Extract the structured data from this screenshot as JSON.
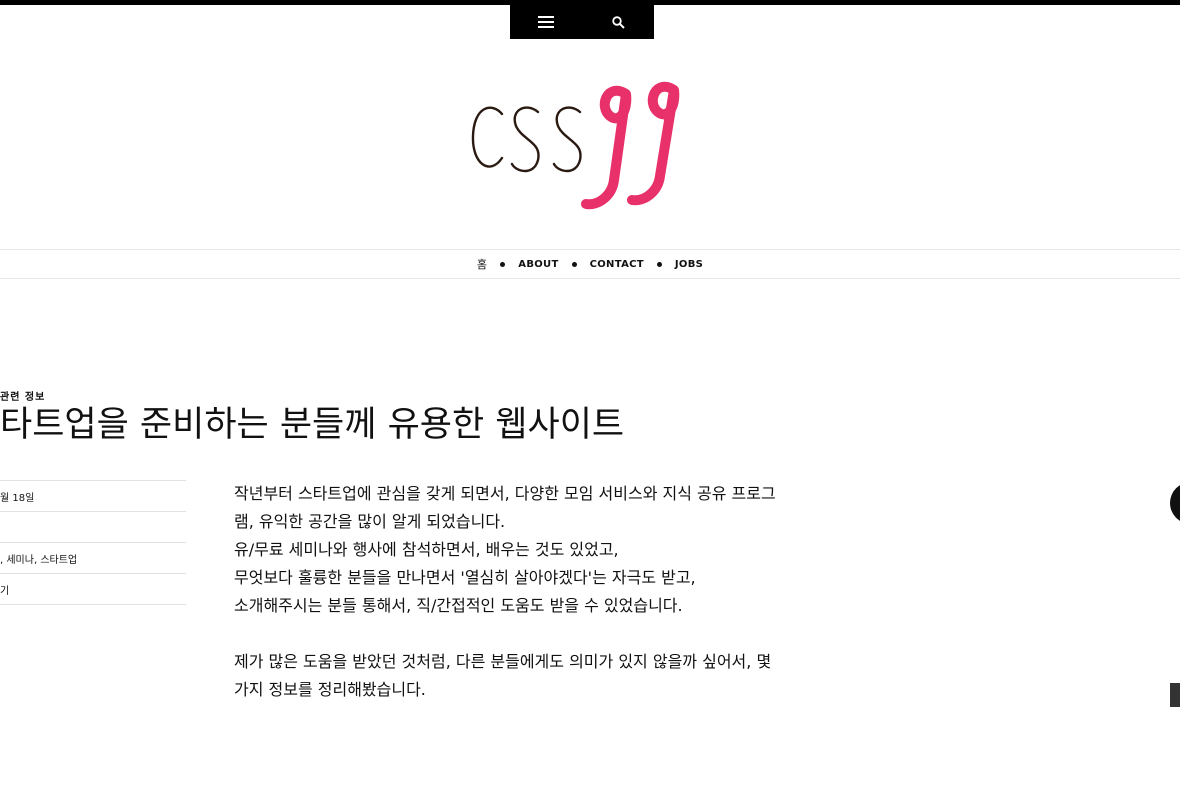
{
  "toolbar": {
    "menu_icon": "menu-icon",
    "search_icon": "search-icon"
  },
  "logo": {
    "text": "CSS",
    "number": "99",
    "colors": {
      "text": "#2a1a12",
      "number": "#e8306a"
    }
  },
  "nav": {
    "items": [
      {
        "label": "홈"
      },
      {
        "label": "ABOUT"
      },
      {
        "label": "CONTACT"
      },
      {
        "label": "JOBS"
      }
    ]
  },
  "post": {
    "category": "관련 정보",
    "title": "타트업을 준비하는 분들께 유용한 웹사이트",
    "meta": [
      {
        "text": "월 18일"
      },
      {
        "text": ""
      },
      {
        "text": ", 세미나, 스타트업"
      },
      {
        "text": "기"
      }
    ],
    "paragraphs": [
      {
        "lines": [
          "작년부터 스타트업에 관심을 갖게 되면서, 다양한 모임 서비스와 지식 공유 프로그",
          "램, 유익한 공간을 많이 알게 되었습니다.",
          "유/무료 세미나와 행사에 참석하면서, 배우는 것도 있었고,",
          "무엇보다 훌륭한 분들을 만나면서 '열심히 살아야겠다'는 자극도 받고,",
          "소개해주시는 분들 통해서, 직/간접적인 도움도 받을 수 있었습니다."
        ]
      },
      {
        "lines": [
          "제가 많은 도움을 받았던 것처럼, 다른 분들에게도 의미가 있지 않을까 싶어서, 몇",
          "가지 정보를 정리해봤습니다."
        ]
      }
    ]
  }
}
